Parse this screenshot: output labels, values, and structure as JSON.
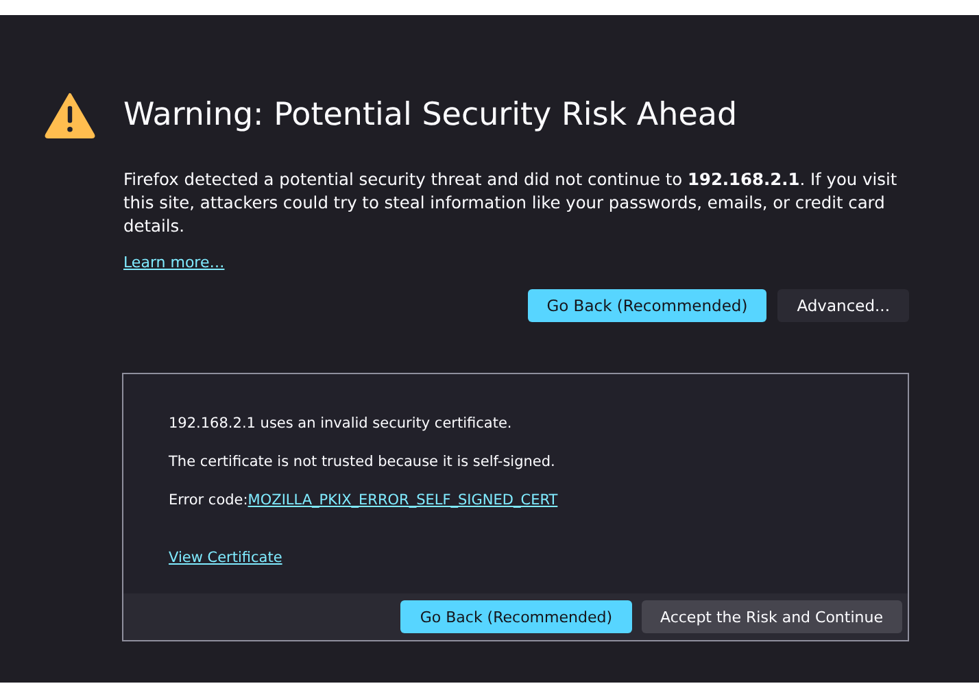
{
  "title": "Warning: Potential Security Risk Ahead",
  "intro": "Firefox detected a potential security threat and did not continue to **192.168.2.1**. If you visit this site, attackers could try to steal information like your passwords, emails, or credit card details.",
  "learn_more": "Learn more…",
  "buttons": [
    {
      "label": "Go Back (Recommended)",
      "kind": "primary"
    },
    {
      "label": "Advanced...",
      "kind": "secondary"
    }
  ],
  "advanced": {
    "lines": [
      "192.168.2.1 uses an invalid security certificate.",
      "The certificate is not trusted because it is self-signed."
    ],
    "error_label": "Error code:",
    "error_code": "MOZILLA_PKIX_ERROR_SELF_SIGNED_CERT",
    "view_certificate": "View Certificate",
    "buttons": [
      {
        "label": "Go Back (Recommended)",
        "kind": "primary"
      },
      {
        "label": "Accept the Risk and Continue",
        "kind": "secondary"
      }
    ]
  }
}
